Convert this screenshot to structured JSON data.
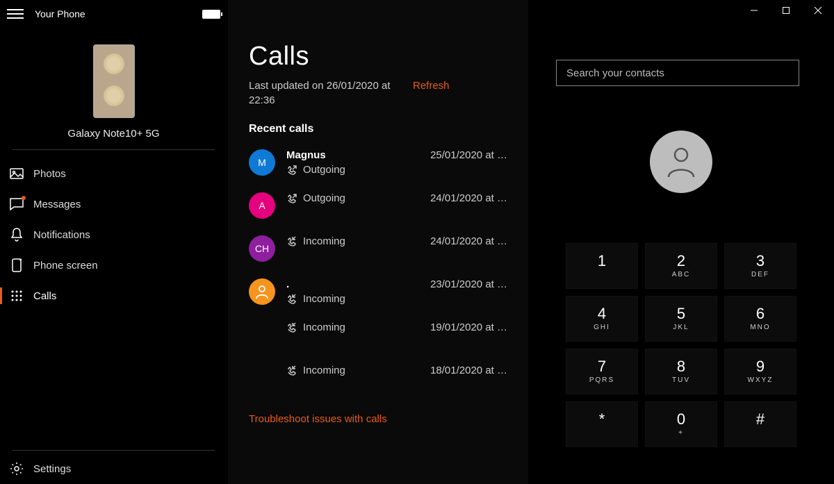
{
  "header": {
    "app_title": "Your Phone"
  },
  "phone": {
    "device_name": "Galaxy Note10+ 5G"
  },
  "sidebar": {
    "items": [
      {
        "label": "Photos",
        "icon": "photo-icon",
        "badge": false
      },
      {
        "label": "Messages",
        "icon": "message-icon",
        "badge": true
      },
      {
        "label": "Notifications",
        "icon": "bell-icon",
        "badge": false
      },
      {
        "label": "Phone screen",
        "icon": "phone-icon",
        "badge": false
      },
      {
        "label": "Calls",
        "icon": "dialpad-icon",
        "badge": false,
        "active": true
      }
    ],
    "settings_label": "Settings"
  },
  "calls": {
    "title": "Calls",
    "updated_text": "Last updated on 26/01/2020 at 22:36",
    "refresh_label": "Refresh",
    "section_title": "Recent calls",
    "troubleshoot_label": "Troubleshoot issues with calls",
    "items": [
      {
        "name": "Magnus",
        "direction": "Outgoing",
        "date": "25/01/2020 at …",
        "initials": "M",
        "color": "#0f7ad6"
      },
      {
        "name": "",
        "direction": "Outgoing",
        "date": "24/01/2020 at …",
        "initials": "A",
        "color": "#e6007e"
      },
      {
        "name": "",
        "direction": "Incoming",
        "date": "24/01/2020 at …",
        "initials": "CH",
        "color": "#8e1f9e"
      },
      {
        "name": ".",
        "direction": "Incoming",
        "date": "23/01/2020 at …",
        "initials": "",
        "color": "#f7941d",
        "generic": true
      },
      {
        "name": "",
        "direction": "Incoming",
        "date": "19/01/2020 at …",
        "initials": "",
        "color": ""
      },
      {
        "name": "",
        "direction": "Incoming",
        "date": "18/01/2020 at …",
        "initials": "",
        "color": ""
      }
    ]
  },
  "dialer": {
    "search_placeholder": "Search your contacts",
    "keys": [
      {
        "num": "1",
        "sub": ""
      },
      {
        "num": "2",
        "sub": "ABC"
      },
      {
        "num": "3",
        "sub": "DEF"
      },
      {
        "num": "4",
        "sub": "GHI"
      },
      {
        "num": "5",
        "sub": "JKL"
      },
      {
        "num": "6",
        "sub": "MNO"
      },
      {
        "num": "7",
        "sub": "PQRS"
      },
      {
        "num": "8",
        "sub": "TUV"
      },
      {
        "num": "9",
        "sub": "WXYZ"
      },
      {
        "num": "*",
        "sub": ""
      },
      {
        "num": "0",
        "sub": "+"
      },
      {
        "num": "#",
        "sub": ""
      }
    ]
  }
}
